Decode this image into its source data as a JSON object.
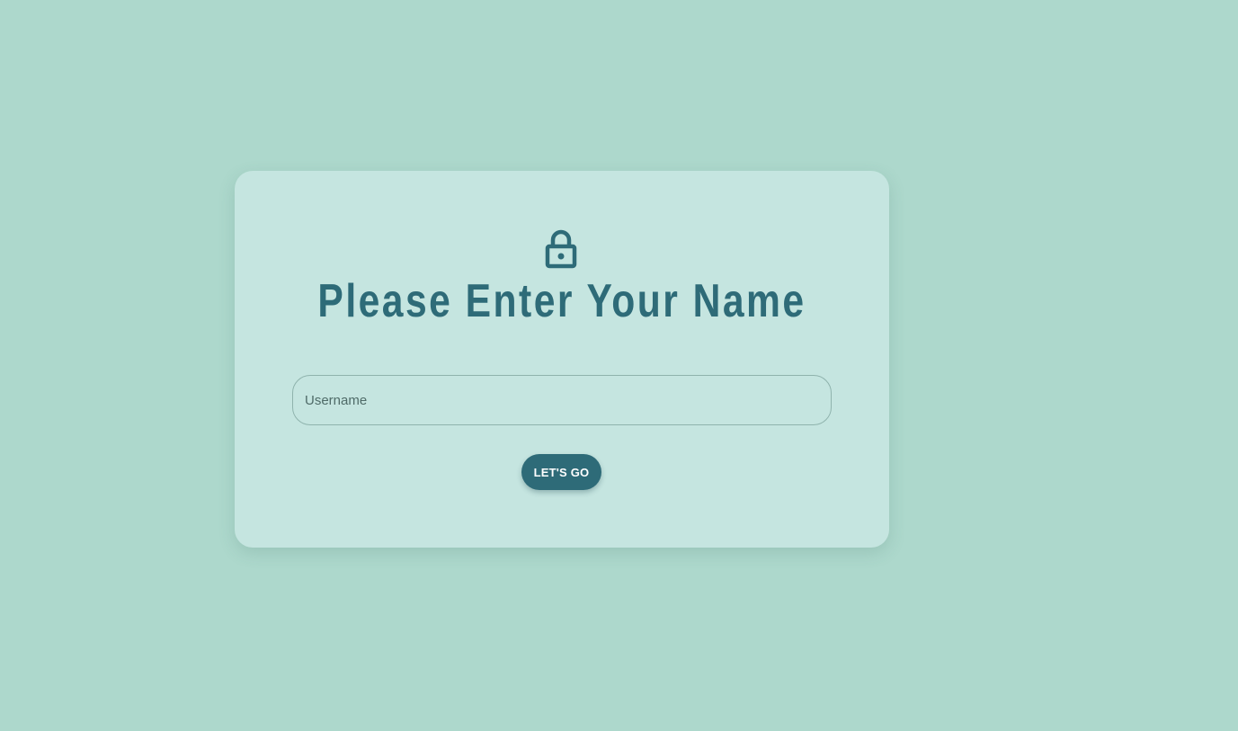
{
  "login": {
    "icon": "lock-icon",
    "title": "Please Enter Your Name",
    "username_placeholder": "Username",
    "username_value": "",
    "submit_label": "LET'S GO"
  },
  "colors": {
    "background": "#add8cc",
    "card": "#c5e5e0",
    "accent": "#2e6b78",
    "button_text": "#ffffff"
  }
}
